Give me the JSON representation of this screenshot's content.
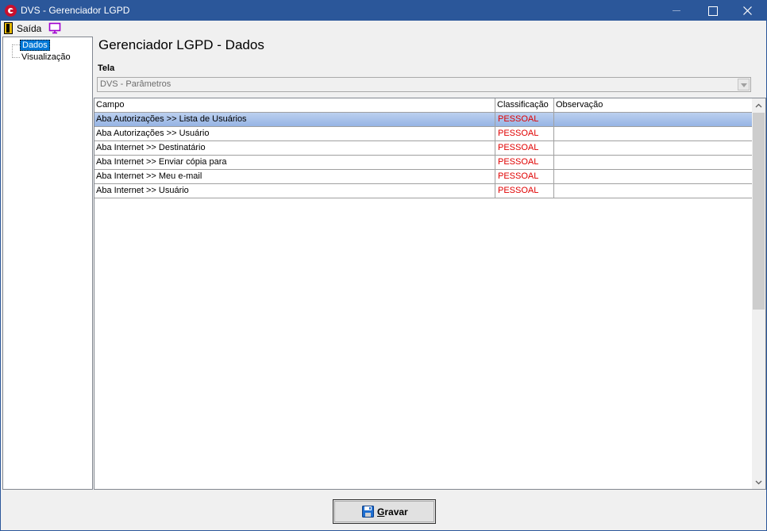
{
  "window": {
    "title": "DVS - Gerenciador LGPD"
  },
  "menu": {
    "exit_label": "Saída"
  },
  "tree": {
    "items": [
      {
        "label": "Dados",
        "selected": true
      },
      {
        "label": "Visualização",
        "selected": false
      }
    ]
  },
  "main": {
    "title": "Gerenciador LGPD - Dados",
    "tela_label": "Tela",
    "tela_value": "DVS - Parâmetros"
  },
  "grid": {
    "columns": [
      "Campo",
      "Classificação",
      "Observação"
    ],
    "rows": [
      {
        "campo": "Aba Autorizações >> Lista de Usuários",
        "classificacao": "PESSOAL",
        "observacao": ""
      },
      {
        "campo": "Aba Autorizações >> Usuário",
        "classificacao": "PESSOAL",
        "observacao": ""
      },
      {
        "campo": "Aba Internet >> Destinatário",
        "classificacao": "PESSOAL",
        "observacao": ""
      },
      {
        "campo": "Aba Internet >> Enviar cópia para",
        "classificacao": "PESSOAL",
        "observacao": ""
      },
      {
        "campo": "Aba Internet >> Meu e-mail",
        "classificacao": "PESSOAL",
        "observacao": ""
      },
      {
        "campo": "Aba Internet >> Usuário",
        "classificacao": "PESSOAL",
        "observacao": ""
      }
    ]
  },
  "footer": {
    "save_label_first": "G",
    "save_label_rest": "ravar"
  },
  "colors": {
    "titlebar": "#2b579a",
    "selection": "#0078d7",
    "classification_text": "#e00000"
  },
  "icons": {
    "app": "app-logo-icon",
    "exit": "door-exit-icon",
    "view": "monitor-icon",
    "save": "floppy-disk-icon"
  }
}
